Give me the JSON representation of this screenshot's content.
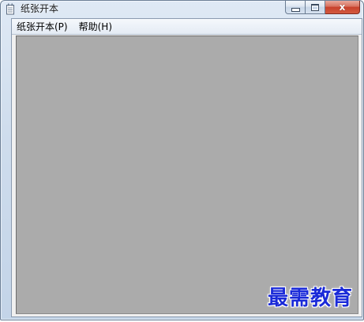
{
  "window": {
    "title": "纸张开本"
  },
  "caption_buttons": {
    "close_glyph": "x"
  },
  "menubar": {
    "items": [
      {
        "label": "纸张开本(P)"
      },
      {
        "label": "帮助(H)"
      }
    ]
  },
  "watermark": {
    "text": "最需教育"
  },
  "icons": {
    "app": "notepad-icon",
    "minimize": "minimize-icon",
    "maximize": "maximize-icon",
    "close": "close-icon"
  },
  "colors": {
    "canvas": "#ababab",
    "watermark": "#1a2ad8",
    "close_button": "#c7412c"
  }
}
